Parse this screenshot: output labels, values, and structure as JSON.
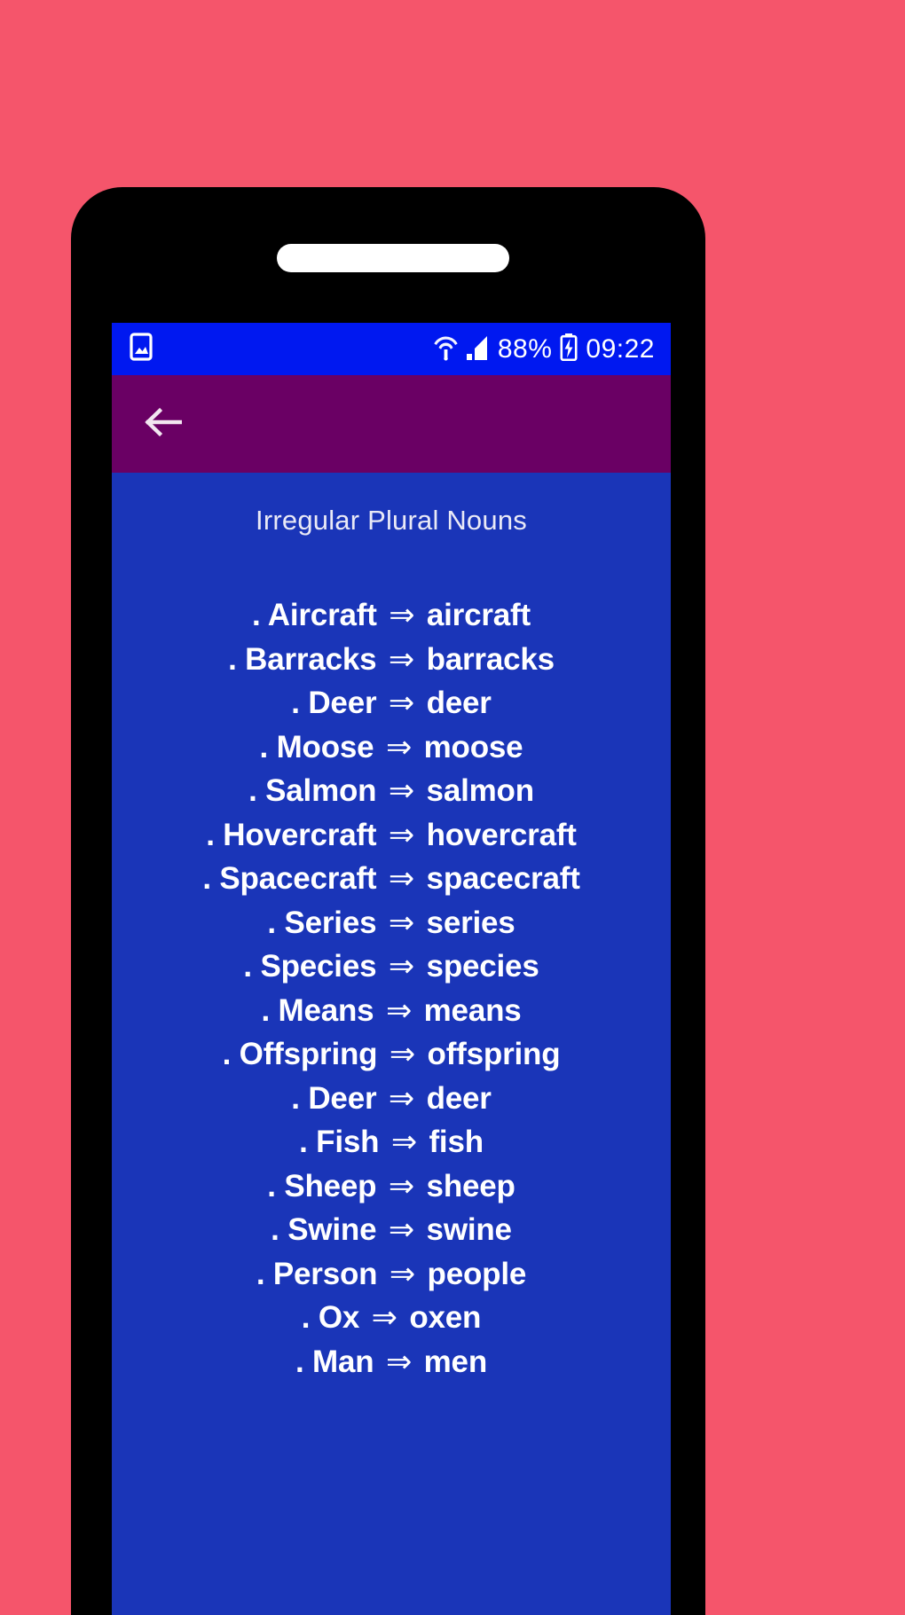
{
  "theme": {
    "page_background": "#f5556b",
    "phone_body": "#000000",
    "status_bar": "#0018f0",
    "app_bar": "#6a0064",
    "content_background": "#1a35b8",
    "text": "#ffffff"
  },
  "status_bar": {
    "notification_icon": "image-icon",
    "wifi_icon": "wifi-icon",
    "signal_icon": "cellular-signal-icon",
    "battery_percent": "88%",
    "battery_icon": "battery-charging-icon",
    "clock": "09:22"
  },
  "app_bar": {
    "back_icon": "arrow-left-icon",
    "title": ""
  },
  "content": {
    "title": "Irregular Plural Nouns",
    "bullet": ".",
    "arrow": "⇒",
    "items": [
      {
        "singular": "Aircraft",
        "plural": "aircraft"
      },
      {
        "singular": "Barracks",
        "plural": "barracks"
      },
      {
        "singular": "Deer",
        "plural": "deer"
      },
      {
        "singular": "Moose",
        "plural": "moose"
      },
      {
        "singular": "Salmon",
        "plural": "salmon"
      },
      {
        "singular": "Hovercraft",
        "plural": "hovercraft"
      },
      {
        "singular": "Spacecraft",
        "plural": "spacecraft"
      },
      {
        "singular": "Series",
        "plural": "series"
      },
      {
        "singular": "Species",
        "plural": "species"
      },
      {
        "singular": "Means",
        "plural": "means"
      },
      {
        "singular": "Offspring",
        "plural": "offspring"
      },
      {
        "singular": "Deer",
        "plural": "deer"
      },
      {
        "singular": "Fish",
        "plural": "fish"
      },
      {
        "singular": "Sheep",
        "plural": "sheep"
      },
      {
        "singular": "Swine",
        "plural": "swine"
      },
      {
        "singular": "Person",
        "plural": "people"
      },
      {
        "singular": "Ox",
        "plural": "oxen"
      },
      {
        "singular": "Man",
        "plural": "men"
      }
    ]
  }
}
